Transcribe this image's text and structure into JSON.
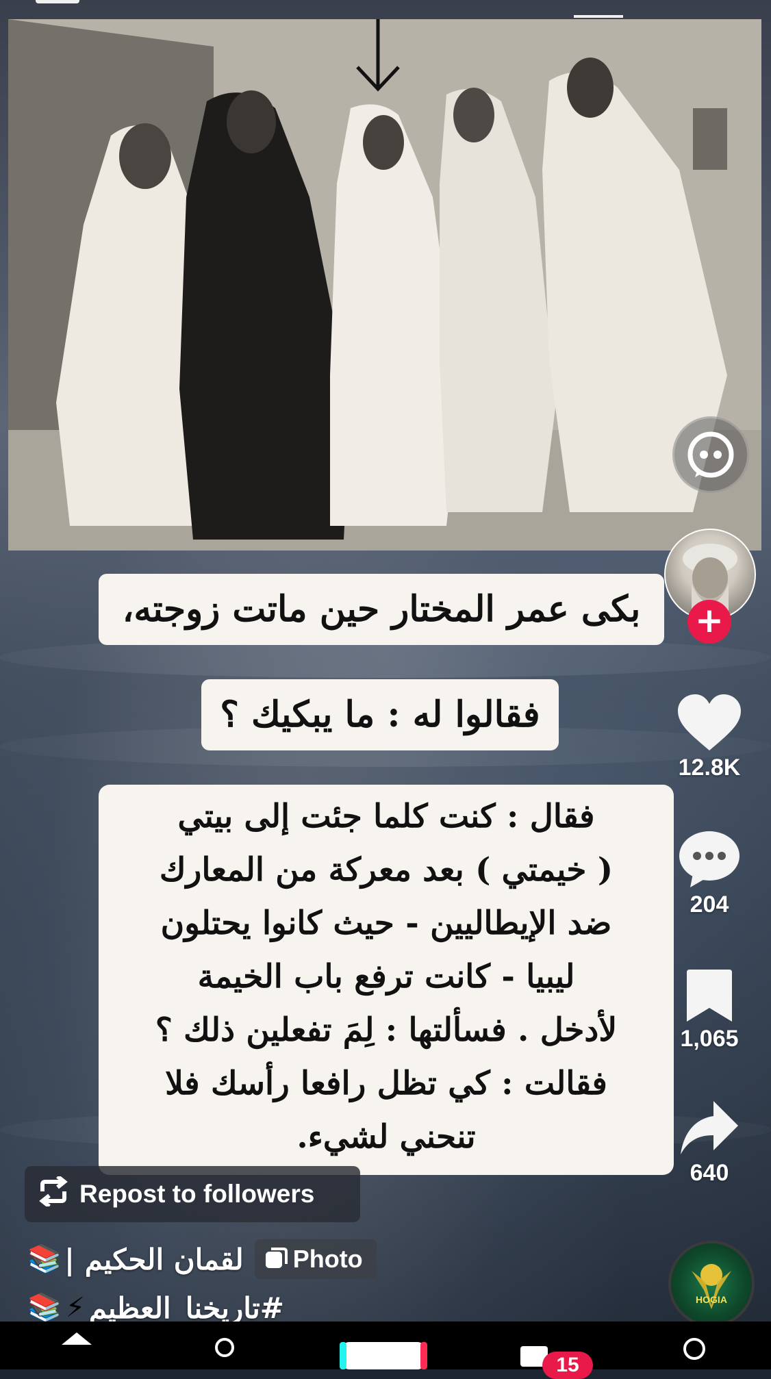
{
  "caption": {
    "line1": "بكى عمر المختار حين ماتت زوجته،",
    "line2": "فقالوا له : ما يبكيك ؟",
    "body_lines": [
      "فقال : كنت كلما جئت إلى بيتي",
      "( خيمتي ) بعد معركة من المعارك",
      "ضد الإيطاليين - حيث كانوا يحتلون",
      "ليبيا - كانت ترفع باب الخيمة",
      "لأدخل . فسألتها : لِمَ تفعلين ذلك ؟",
      "فقالت : كي تظل رافعا رأسك فلا",
      "تنحني لشيء."
    ]
  },
  "actions": {
    "likes": "12.8K",
    "comments": "204",
    "saves": "1,065",
    "shares": "640"
  },
  "repost": {
    "label": "Repost to followers",
    "icon": "repost-icon"
  },
  "author": {
    "name": "لقمان الحكيم |",
    "emoji": "📚",
    "badge_label": "Photo"
  },
  "hashtag": {
    "text": "#تاريخنا_العظيم",
    "emoji_left": "📚",
    "emoji_mid": "⚡"
  },
  "music": {
    "label": "HOGIA"
  },
  "nav": {
    "inbox_badge": "15"
  },
  "colors": {
    "accent": "#e9194a",
    "caption_bg": "#f7f3ee"
  }
}
